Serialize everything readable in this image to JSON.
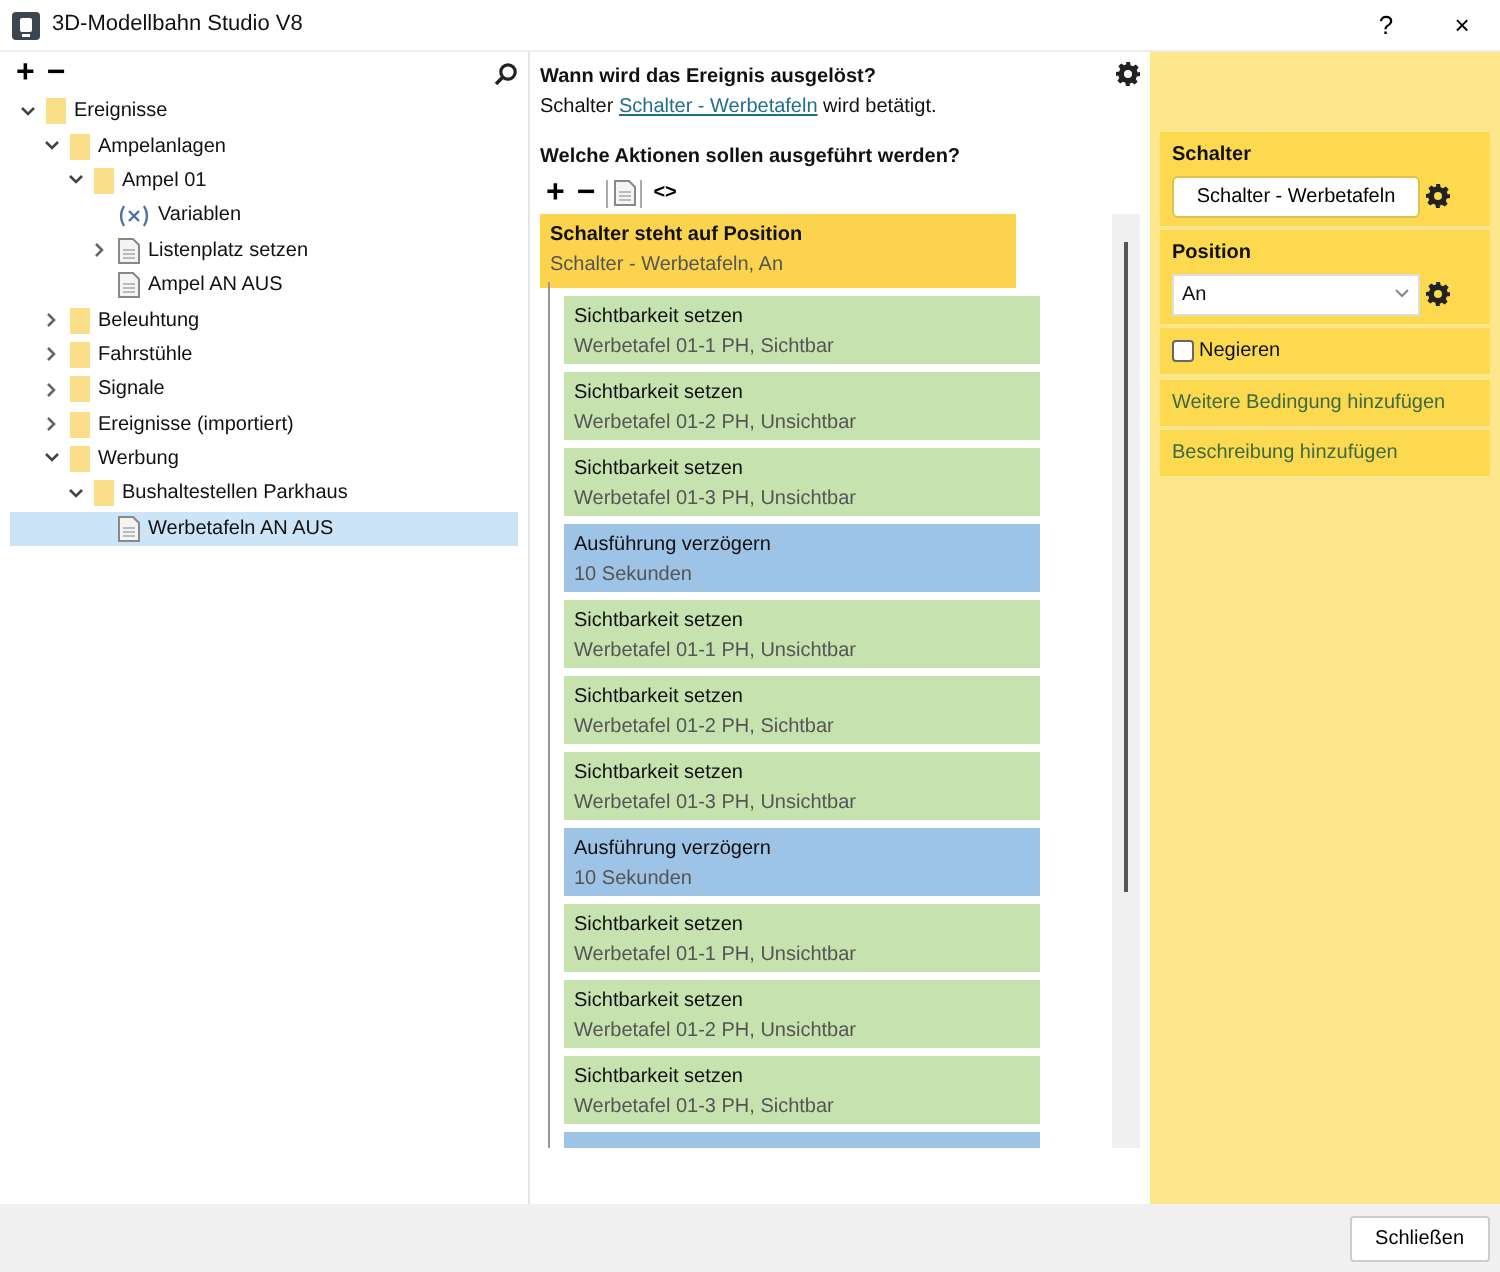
{
  "window": {
    "title": "3D-Modellbahn Studio V8",
    "buttons": [
      "?",
      "×"
    ]
  },
  "tree": {
    "toolbar": [
      "+",
      "−"
    ],
    "items": [
      {
        "label": "Ereignisse",
        "kind": "folder",
        "expanded": true,
        "selected": false,
        "children": [
          {
            "label": "Ampelanlagen",
            "kind": "folder",
            "expanded": true,
            "selected": false,
            "children": [
              {
                "label": "Ampel 01",
                "kind": "folder",
                "expanded": true,
                "selected": false,
                "children": [
                  {
                    "label": "Variablen",
                    "kind": "variable",
                    "selected": false
                  },
                  {
                    "label": "Listenplatz setzen",
                    "kind": "file",
                    "expanded": false,
                    "selected": false
                  },
                  {
                    "label": "Ampel AN AUS",
                    "kind": "file",
                    "selected": false
                  }
                ]
              }
            ]
          },
          {
            "label": "Beleuhtung",
            "kind": "folder",
            "expanded": false,
            "selected": false
          },
          {
            "label": "Fahrstühle",
            "kind": "folder",
            "expanded": false,
            "selected": false
          },
          {
            "label": "Signale",
            "kind": "folder",
            "expanded": false,
            "selected": false
          },
          {
            "label": "Ereignisse (importiert)",
            "kind": "folder",
            "expanded": false,
            "selected": false
          },
          {
            "label": "Werbung",
            "kind": "folder",
            "expanded": true,
            "selected": false,
            "children": [
              {
                "label": "Bushaltestellen Parkhaus",
                "kind": "folder",
                "expanded": true,
                "selected": false,
                "children": [
                  {
                    "label": "Werbetafeln AN AUS",
                    "kind": "file",
                    "selected": true
                  }
                ]
              }
            ]
          }
        ]
      }
    ]
  },
  "trigger": {
    "heading": "Wann wird das Ereignis ausgelöst?",
    "prefix": "Schalter",
    "link": "Schalter - Werbetafeln",
    "suffix": "wird betätigt."
  },
  "actions": {
    "heading": "Welche Aktionen sollen ausgeführt werden?",
    "toolbar": [
      "+",
      "−",
      "<>"
    ],
    "condition": {
      "title": "Schalter steht auf Position",
      "detail": "Schalter - Werbetafeln, An",
      "selected": true
    },
    "items": [
      {
        "kind": "visibility",
        "title": "Sichtbarkeit setzen",
        "detail": "Werbetafel 01-1 PH, Sichtbar"
      },
      {
        "kind": "visibility",
        "title": "Sichtbarkeit setzen",
        "detail": "Werbetafel 01-2 PH, Unsichtbar"
      },
      {
        "kind": "visibility",
        "title": "Sichtbarkeit setzen",
        "detail": "Werbetafel 01-3 PH, Unsichtbar"
      },
      {
        "kind": "delay",
        "title": "Ausführung verzögern",
        "detail": "10 Sekunden"
      },
      {
        "kind": "visibility",
        "title": "Sichtbarkeit setzen",
        "detail": "Werbetafel 01-1 PH, Unsichtbar"
      },
      {
        "kind": "visibility",
        "title": "Sichtbarkeit setzen",
        "detail": "Werbetafel 01-2 PH, Sichtbar"
      },
      {
        "kind": "visibility",
        "title": "Sichtbarkeit setzen",
        "detail": "Werbetafel 01-3 PH, Unsichtbar"
      },
      {
        "kind": "delay",
        "title": "Ausführung verzögern",
        "detail": "10 Sekunden"
      },
      {
        "kind": "visibility",
        "title": "Sichtbarkeit setzen",
        "detail": "Werbetafel 01-1 PH, Unsichtbar"
      },
      {
        "kind": "visibility",
        "title": "Sichtbarkeit setzen",
        "detail": "Werbetafel 01-2 PH, Unsichtbar"
      },
      {
        "kind": "visibility",
        "title": "Sichtbarkeit setzen",
        "detail": "Werbetafel 01-3 PH, Sichtbar"
      },
      {
        "kind": "delay"
      }
    ]
  },
  "properties": {
    "switch_label": "Schalter",
    "switch_value": "Schalter - Werbetafeln",
    "position_label": "Position",
    "position_value": "An",
    "negate": {
      "label": "Negieren",
      "checked": false
    },
    "links": [
      "Weitere Bedingung hinzufügen",
      "Beschreibung hinzufügen"
    ]
  },
  "footer": {
    "close_button": "Schließen"
  }
}
